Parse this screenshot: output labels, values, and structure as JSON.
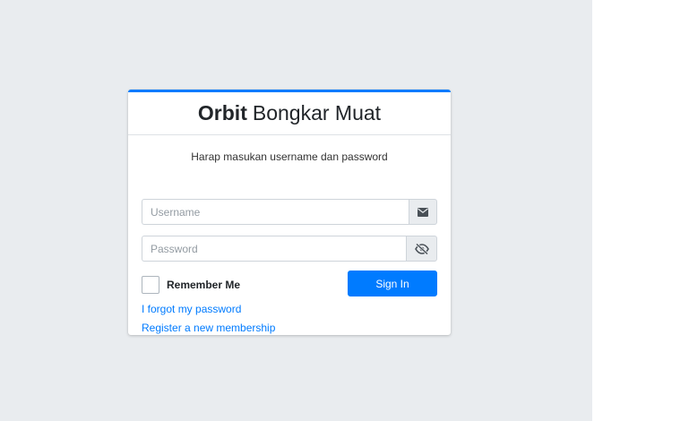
{
  "brand": {
    "bold": "Orbit",
    "light": "Bongkar Muat",
    "accent_color": "#007bff"
  },
  "login": {
    "message": "Harap masukan username dan password",
    "username_placeholder": "Username",
    "username_icon": "envelope-icon",
    "password_placeholder": "Password",
    "password_icon": "eye-slash-icon",
    "remember_label": "Remember Me",
    "signin_label": "Sign In",
    "forgot_link": "I forgot my password",
    "register_link": "Register a new membership"
  }
}
